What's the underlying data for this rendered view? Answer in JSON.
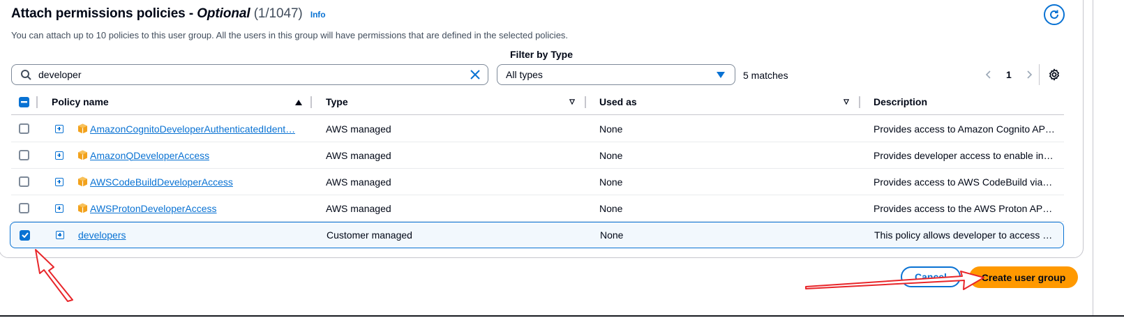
{
  "header": {
    "title_main": "Attach permissions policies - ",
    "title_optional": "Optional",
    "title_count": "(1/1047)",
    "info_label": "Info",
    "subtitle": "You can attach up to 10 policies to this user group. All the users in this group will have permissions that are defined in the selected policies."
  },
  "filters": {
    "search_value": "developer",
    "filter_label": "Filter by Type",
    "type_selected": "All types",
    "matches": "5 matches"
  },
  "pagination": {
    "current_page": "1"
  },
  "table": {
    "columns": {
      "name": "Policy name",
      "type": "Type",
      "used_as": "Used as",
      "description": "Description"
    },
    "rows": [
      {
        "name": "AmazonCognitoDeveloperAuthenticatedIdent…",
        "aws_icon": true,
        "type": "AWS managed",
        "used_as": "None",
        "description": "Provides access to Amazon Cognito AP…",
        "checked": false
      },
      {
        "name": "AmazonQDeveloperAccess",
        "aws_icon": true,
        "type": "AWS managed",
        "used_as": "None",
        "description": "Provides developer access to enable in…",
        "checked": false
      },
      {
        "name": "AWSCodeBuildDeveloperAccess",
        "aws_icon": true,
        "type": "AWS managed",
        "used_as": "None",
        "description": "Provides access to AWS CodeBuild via …",
        "checked": false
      },
      {
        "name": "AWSProtonDeveloperAccess",
        "aws_icon": true,
        "type": "AWS managed",
        "used_as": "None",
        "description": "Provides access to the AWS Proton API…",
        "checked": false
      },
      {
        "name": "developers",
        "aws_icon": false,
        "type": "Customer managed",
        "used_as": "None",
        "description": "This policy allows developer to access …",
        "checked": true
      }
    ]
  },
  "actions": {
    "cancel_label": "Cancel",
    "create_label": "Create user group"
  },
  "colors": {
    "accent": "#0972d3",
    "primary_button": "#ff9900",
    "annotation": "#e8262a"
  }
}
